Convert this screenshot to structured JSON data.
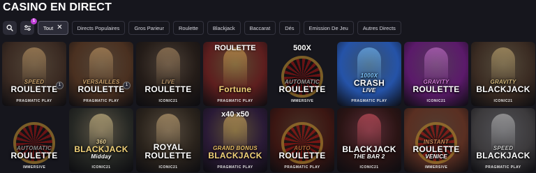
{
  "page": {
    "title": "CASINO EN DIRECT"
  },
  "filters": {
    "search_icon": "search-icon",
    "settings_icon": "sliders-icon",
    "settings_badge": "1",
    "chips": [
      {
        "label": "Tout",
        "active": true
      },
      {
        "label": "Directs Populaires",
        "active": false
      },
      {
        "label": "Gros Parieur",
        "active": false
      },
      {
        "label": "Roulette",
        "active": false
      },
      {
        "label": "Blackjack",
        "active": false
      },
      {
        "label": "Baccarat",
        "active": false
      },
      {
        "label": "Dés",
        "active": false
      },
      {
        "label": "Emission De Jeu",
        "active": false
      },
      {
        "label": "Autres Directs",
        "active": false
      }
    ]
  },
  "games": [
    {
      "pre": "SPEED",
      "title": "ROULETTE",
      "logo": "PRAGMATIC PLAY",
      "count": "1",
      "bg": "#3a2a22",
      "accent": "#c9a16b",
      "kind": "dealer"
    },
    {
      "pre": "VERSAILLES",
      "title": "ROULETTE",
      "logo": "PRAGMATIC PLAY",
      "count": "1",
      "bg": "#4a3020",
      "accent": "#caa06a",
      "kind": "dealer"
    },
    {
      "pre": "LIVE",
      "title": "ROULETTE",
      "logo": "ICONIC21",
      "count": "",
      "bg": "#241c18",
      "accent": "#b9956a",
      "kind": "dealer"
    },
    {
      "pre": "",
      "title": "Fortune",
      "logo": "PRAGMATIC PLAY",
      "count": "",
      "bg": "#5d1e1e",
      "accent": "#e1b15a",
      "kind": "dealer",
      "tag": "ROULETTE"
    },
    {
      "pre": "AUTOMATIC",
      "title": "ROULETTE",
      "logo": "IMMERSIVE",
      "count": "",
      "bg": "#2a2e33",
      "accent": "#999",
      "kind": "wheel",
      "tag": "500X"
    },
    {
      "pre": "1000X",
      "title": "CRASH",
      "logo": "PRAGMATIC PLAY",
      "count": "",
      "bg": "#2553a8",
      "accent": "#7fc7ff",
      "kind": "dealer",
      "sub": "LIVE"
    },
    {
      "pre": "GRAVITY",
      "title": "ROULETTE",
      "logo": "ICONIC21",
      "count": "",
      "bg": "#5b1a6a",
      "accent": "#d07ad5",
      "kind": "dealer"
    },
    {
      "pre": "GRAVITY",
      "title": "BLACKJACK",
      "logo": "ICONIC21",
      "count": "",
      "bg": "#3a2b22",
      "accent": "#d1b67a",
      "kind": "dealer"
    },
    {
      "pre": "AUTOMATIC",
      "title": "ROULETTE",
      "logo": "IMMERSIVE",
      "count": "",
      "bg": "#1e1e24",
      "accent": "#888",
      "kind": "wheel"
    },
    {
      "pre": "360",
      "title": "BLACKJACK",
      "logo": "ICONIC21",
      "count": "",
      "bg": "#262824",
      "accent": "#e7d095",
      "kind": "dealer",
      "sub": "Midday"
    },
    {
      "pre": "",
      "title": "ROYAL ROULETTE",
      "logo": "ICONIC21",
      "count": "",
      "bg": "#2a231c",
      "accent": "#d7b580",
      "kind": "dealer"
    },
    {
      "pre": "GRAND BONUS",
      "title": "BLACKJACK",
      "logo": "PRAGMATIC PLAY",
      "count": "",
      "bg": "#2a1a36",
      "accent": "#e6bc63",
      "kind": "dealer",
      "tag": "x40   x50"
    },
    {
      "pre": "AUTO",
      "title": "ROULETTE",
      "logo": "PRAGMATIC PLAY",
      "count": "",
      "bg": "#3b1612",
      "accent": "#aa6a3a",
      "kind": "wheel"
    },
    {
      "pre": "",
      "title": "BLACKJACK",
      "logo": "ICONIC21",
      "count": "",
      "bg": "#2a1414",
      "accent": "#e25a6a",
      "kind": "dealer",
      "sub": "THE BAR 2"
    },
    {
      "pre": "INSTANT",
      "title": "ROULETTE",
      "logo": "IMMERSIVE",
      "count": "",
      "bg": "#5a2f22",
      "accent": "#c98a5a",
      "kind": "wheel",
      "sub": "VENICE"
    },
    {
      "pre": "SPEED",
      "title": "BLACKJACK",
      "logo": "PRAGMATIC PLAY",
      "count": "",
      "bg": "#3c3a3c",
      "accent": "#c8c8c8",
      "kind": "dealer"
    }
  ]
}
